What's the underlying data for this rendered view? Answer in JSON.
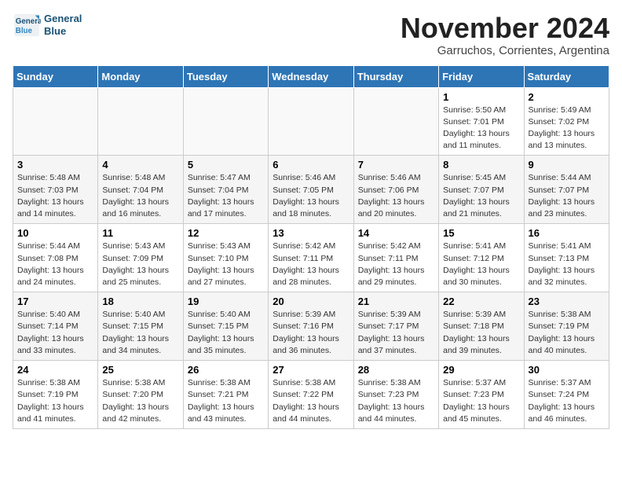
{
  "header": {
    "logo_line1": "General",
    "logo_line2": "Blue",
    "month_title": "November 2024",
    "subtitle": "Garruchos, Corrientes, Argentina"
  },
  "days_of_week": [
    "Sunday",
    "Monday",
    "Tuesday",
    "Wednesday",
    "Thursday",
    "Friday",
    "Saturday"
  ],
  "weeks": [
    [
      {
        "day": "",
        "detail": ""
      },
      {
        "day": "",
        "detail": ""
      },
      {
        "day": "",
        "detail": ""
      },
      {
        "day": "",
        "detail": ""
      },
      {
        "day": "",
        "detail": ""
      },
      {
        "day": "1",
        "detail": "Sunrise: 5:50 AM\nSunset: 7:01 PM\nDaylight: 13 hours\nand 11 minutes."
      },
      {
        "day": "2",
        "detail": "Sunrise: 5:49 AM\nSunset: 7:02 PM\nDaylight: 13 hours\nand 13 minutes."
      }
    ],
    [
      {
        "day": "3",
        "detail": "Sunrise: 5:48 AM\nSunset: 7:03 PM\nDaylight: 13 hours\nand 14 minutes."
      },
      {
        "day": "4",
        "detail": "Sunrise: 5:48 AM\nSunset: 7:04 PM\nDaylight: 13 hours\nand 16 minutes."
      },
      {
        "day": "5",
        "detail": "Sunrise: 5:47 AM\nSunset: 7:04 PM\nDaylight: 13 hours\nand 17 minutes."
      },
      {
        "day": "6",
        "detail": "Sunrise: 5:46 AM\nSunset: 7:05 PM\nDaylight: 13 hours\nand 18 minutes."
      },
      {
        "day": "7",
        "detail": "Sunrise: 5:46 AM\nSunset: 7:06 PM\nDaylight: 13 hours\nand 20 minutes."
      },
      {
        "day": "8",
        "detail": "Sunrise: 5:45 AM\nSunset: 7:07 PM\nDaylight: 13 hours\nand 21 minutes."
      },
      {
        "day": "9",
        "detail": "Sunrise: 5:44 AM\nSunset: 7:07 PM\nDaylight: 13 hours\nand 23 minutes."
      }
    ],
    [
      {
        "day": "10",
        "detail": "Sunrise: 5:44 AM\nSunset: 7:08 PM\nDaylight: 13 hours\nand 24 minutes."
      },
      {
        "day": "11",
        "detail": "Sunrise: 5:43 AM\nSunset: 7:09 PM\nDaylight: 13 hours\nand 25 minutes."
      },
      {
        "day": "12",
        "detail": "Sunrise: 5:43 AM\nSunset: 7:10 PM\nDaylight: 13 hours\nand 27 minutes."
      },
      {
        "day": "13",
        "detail": "Sunrise: 5:42 AM\nSunset: 7:11 PM\nDaylight: 13 hours\nand 28 minutes."
      },
      {
        "day": "14",
        "detail": "Sunrise: 5:42 AM\nSunset: 7:11 PM\nDaylight: 13 hours\nand 29 minutes."
      },
      {
        "day": "15",
        "detail": "Sunrise: 5:41 AM\nSunset: 7:12 PM\nDaylight: 13 hours\nand 30 minutes."
      },
      {
        "day": "16",
        "detail": "Sunrise: 5:41 AM\nSunset: 7:13 PM\nDaylight: 13 hours\nand 32 minutes."
      }
    ],
    [
      {
        "day": "17",
        "detail": "Sunrise: 5:40 AM\nSunset: 7:14 PM\nDaylight: 13 hours\nand 33 minutes."
      },
      {
        "day": "18",
        "detail": "Sunrise: 5:40 AM\nSunset: 7:15 PM\nDaylight: 13 hours\nand 34 minutes."
      },
      {
        "day": "19",
        "detail": "Sunrise: 5:40 AM\nSunset: 7:15 PM\nDaylight: 13 hours\nand 35 minutes."
      },
      {
        "day": "20",
        "detail": "Sunrise: 5:39 AM\nSunset: 7:16 PM\nDaylight: 13 hours\nand 36 minutes."
      },
      {
        "day": "21",
        "detail": "Sunrise: 5:39 AM\nSunset: 7:17 PM\nDaylight: 13 hours\nand 37 minutes."
      },
      {
        "day": "22",
        "detail": "Sunrise: 5:39 AM\nSunset: 7:18 PM\nDaylight: 13 hours\nand 39 minutes."
      },
      {
        "day": "23",
        "detail": "Sunrise: 5:38 AM\nSunset: 7:19 PM\nDaylight: 13 hours\nand 40 minutes."
      }
    ],
    [
      {
        "day": "24",
        "detail": "Sunrise: 5:38 AM\nSunset: 7:19 PM\nDaylight: 13 hours\nand 41 minutes."
      },
      {
        "day": "25",
        "detail": "Sunrise: 5:38 AM\nSunset: 7:20 PM\nDaylight: 13 hours\nand 42 minutes."
      },
      {
        "day": "26",
        "detail": "Sunrise: 5:38 AM\nSunset: 7:21 PM\nDaylight: 13 hours\nand 43 minutes."
      },
      {
        "day": "27",
        "detail": "Sunrise: 5:38 AM\nSunset: 7:22 PM\nDaylight: 13 hours\nand 44 minutes."
      },
      {
        "day": "28",
        "detail": "Sunrise: 5:38 AM\nSunset: 7:23 PM\nDaylight: 13 hours\nand 44 minutes."
      },
      {
        "day": "29",
        "detail": "Sunrise: 5:37 AM\nSunset: 7:23 PM\nDaylight: 13 hours\nand 45 minutes."
      },
      {
        "day": "30",
        "detail": "Sunrise: 5:37 AM\nSunset: 7:24 PM\nDaylight: 13 hours\nand 46 minutes."
      }
    ]
  ]
}
